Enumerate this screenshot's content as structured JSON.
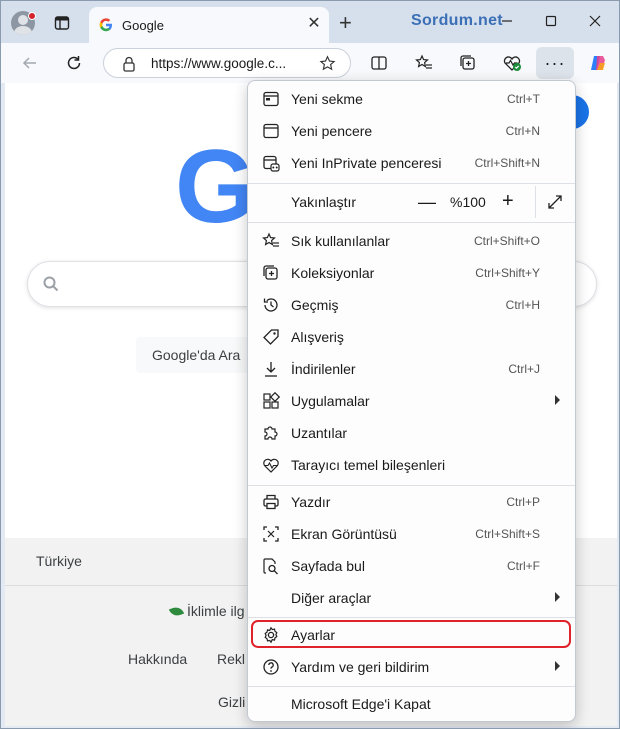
{
  "tab": {
    "title": "Google",
    "close": "✕",
    "new": "+"
  },
  "watermark": "Sordum.net",
  "toolbar": {
    "url": "https://www.google.c...",
    "more": "···"
  },
  "page": {
    "logo": "G",
    "search_button": "Google'da Ara",
    "country": "Türkiye",
    "climate": "İklimle ilg",
    "links": [
      "Hakkında",
      "Rekl",
      "Gizli"
    ]
  },
  "menu": {
    "items": [
      {
        "label": "Yeni sekme",
        "shortcut": "Ctrl+T"
      },
      {
        "label": "Yeni pencere",
        "shortcut": "Ctrl+N"
      },
      {
        "label": "Yeni InPrivate penceresi",
        "shortcut": "Ctrl+Shift+N"
      },
      {
        "label": "Yakınlaştır",
        "shortcut": ""
      },
      {
        "label": "Sık kullanılanlar",
        "shortcut": "Ctrl+Shift+O"
      },
      {
        "label": "Koleksiyonlar",
        "shortcut": "Ctrl+Shift+Y"
      },
      {
        "label": "Geçmiş",
        "shortcut": "Ctrl+H"
      },
      {
        "label": "Alışveriş",
        "shortcut": ""
      },
      {
        "label": "İndirilenler",
        "shortcut": "Ctrl+J"
      },
      {
        "label": "Uygulamalar",
        "shortcut": ""
      },
      {
        "label": "Uzantılar",
        "shortcut": ""
      },
      {
        "label": "Tarayıcı temel bileşenleri",
        "shortcut": ""
      },
      {
        "label": "Yazdır",
        "shortcut": "Ctrl+P"
      },
      {
        "label": "Ekran Görüntüsü",
        "shortcut": "Ctrl+Shift+S"
      },
      {
        "label": "Sayfada bul",
        "shortcut": "Ctrl+F"
      },
      {
        "label": "Diğer araçlar",
        "shortcut": ""
      },
      {
        "label": "Ayarlar",
        "shortcut": ""
      },
      {
        "label": "Yardım ve geri bildirim",
        "shortcut": ""
      },
      {
        "label": "Microsoft Edge'i Kapat",
        "shortcut": ""
      }
    ],
    "zoom": {
      "minus": "—",
      "value": "%100",
      "plus": "+"
    }
  },
  "colors": {
    "highlight": "#e0232b",
    "accent": "#1a73e8"
  }
}
